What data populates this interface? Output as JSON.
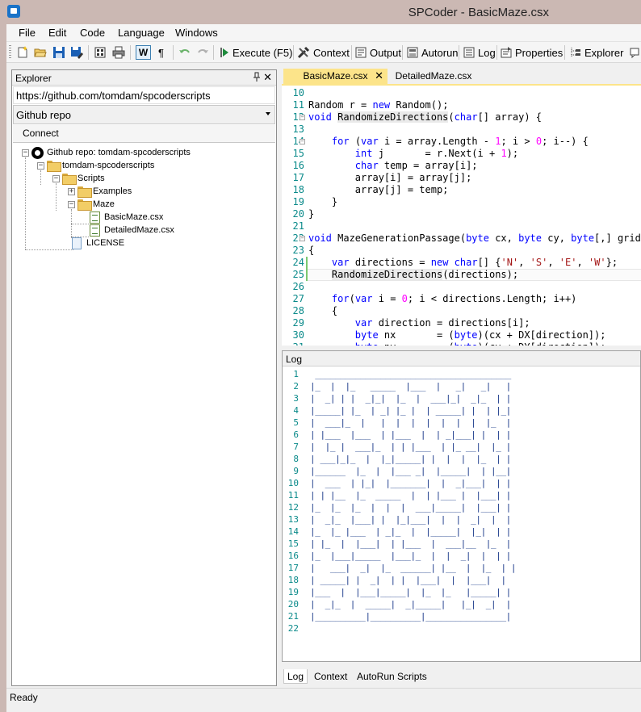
{
  "window": {
    "title": "SPCoder - BasicMaze.csx"
  },
  "menu": [
    "File",
    "Edit",
    "Code",
    "Language",
    "Windows"
  ],
  "toolbar": {
    "wrap_label": "W",
    "pilcrow_label": "¶",
    "execute_label": "Execute (F5)",
    "context_label": "Context",
    "output_label": "Output",
    "autorun_label": "Autorun",
    "log_label": "Log",
    "properties_label": "Properties",
    "explorer_label": "Explorer"
  },
  "explorer": {
    "title": "Explorer",
    "pin": "↕",
    "close": "✕",
    "repo_url": "https://github.com/tomdam/spcoderscripts",
    "source_type": "Github repo",
    "connect_label": "Connect",
    "tree": {
      "root": "Github repo: tomdam-spcoderscripts",
      "repo": "tomdam-spcoderscripts",
      "scripts": "Scripts",
      "examples": "Examples",
      "maze": "Maze",
      "file1": "BasicMaze.csx",
      "file2": "DetailedMaze.csx",
      "license": "LICENSE"
    }
  },
  "editor": {
    "tabs": [
      "BasicMaze.csx",
      "DetailedMaze.csx"
    ],
    "tab_close": "✕",
    "line_numbers": [
      "10",
      "11",
      "12",
      "13",
      "14",
      "15",
      "16",
      "17",
      "18",
      "19",
      "20",
      "21",
      "22",
      "23",
      "24",
      "25",
      "26",
      "27",
      "28",
      "29",
      "30",
      "31"
    ]
  },
  "log": {
    "title": "Log",
    "line_numbers": [
      "1",
      "2",
      "3",
      "4",
      "5",
      "6",
      "7",
      "8",
      "9",
      "10",
      "11",
      "12",
      "13",
      "14",
      "15",
      "16",
      "17",
      "18",
      "19",
      "20",
      "21",
      "22"
    ],
    "lines": [
      " _______________________________________",
      "|_  |  |_   _____  |___  |   _|   _|   |",
      "|  _| | |  _|_|  |_  |  ___|_|  _|_  | |",
      "|_____| |_  | _| |_ |  | _____| |  | |_|",
      "|  ___|_  |   |  |  |  |  |  |  |  |_  |",
      "| |___  |___  | |___  |  | _|___| |  | |",
      "|  |_ |  ___|_  | | |___  | |_ __|  |_ |",
      "| ___|_|_  |  |_|_____| |  |  |  |_  | |",
      "|______  |_  |  |___ _|  |_____|  | |__|",
      "|  ___  | |_|  |_______|  |  _|___|  | |",
      "| | |__  |_  _____  |  | |___ |  |___| |",
      "|_  |_  |_  |  |  |  ___|_____|  |___| |",
      "|  _|_  |___| |  |_|___|  |  |  _|  |  |",
      "|_  |_ |___  | _|_  |  |_____|  |_|  | |",
      "| |_  |  |___|  | |___  |  ___|__  |_  |",
      "|_  |___|_____  |___|_  |  |  _|  |  | |",
      "|   ___|  _|  |_  ______| |__  |  |_  | |",
      "| _____| |  _|  | |  |___|  |  |___|  |",
      "|___  |  |___|_____|  |_  |_   |_____| |",
      "|  _|_  |  _____|  _|_____|   |_|  _|  |",
      "|__________|__________|________________|",
      ""
    ]
  },
  "bottom_tabs": [
    "Log",
    "Context",
    "AutoRun Scripts"
  ],
  "status": {
    "text": "Ready"
  }
}
